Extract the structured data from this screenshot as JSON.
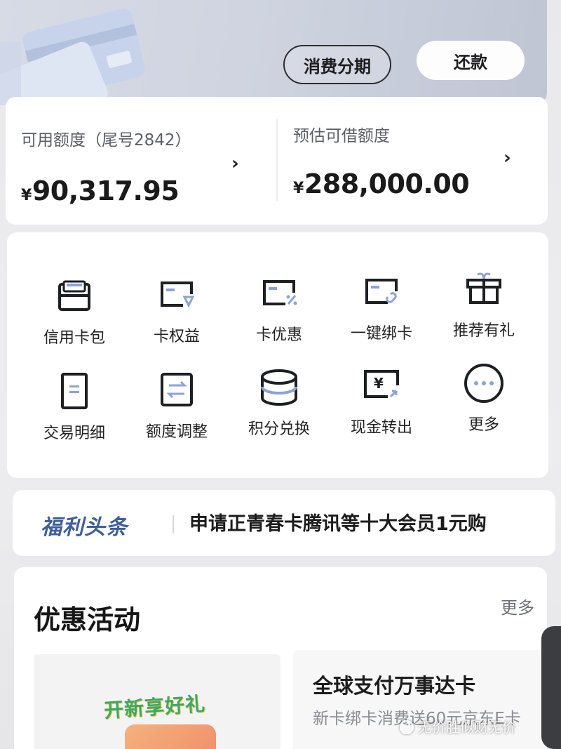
{
  "header": {
    "installment_button": "消费分期",
    "repay_button": "还款"
  },
  "credit": {
    "available_label": "可用额度（尾号2842）",
    "available_currency": "¥",
    "available_amount": "90,317.95",
    "borrow_label": "预估可借额度",
    "borrow_currency": "¥",
    "borrow_amount": "288,000.00"
  },
  "services": [
    {
      "label": "信用卡包",
      "icon": "card-wallet-icon"
    },
    {
      "label": "卡权益",
      "icon": "card-benefit-icon"
    },
    {
      "label": "卡优惠",
      "icon": "card-discount-icon"
    },
    {
      "label": "一键绑卡",
      "icon": "card-link-icon"
    },
    {
      "label": "推荐有礼",
      "icon": "gift-icon"
    },
    {
      "label": "交易明细",
      "icon": "document-icon"
    },
    {
      "label": "额度调整",
      "icon": "swap-arrows-icon"
    },
    {
      "label": "积分兑换",
      "icon": "coin-stack-icon"
    },
    {
      "label": "现金转出",
      "icon": "cash-transfer-icon"
    },
    {
      "label": "更多",
      "icon": "more-dots-icon"
    }
  ],
  "news": {
    "tag": "福利头条",
    "headline": "申请正青春卡腾讯等十大会员1元购"
  },
  "promo": {
    "title": "优惠活动",
    "more": "更多",
    "left_banner": "开新享好礼",
    "right_title": "全球支付万事达卡",
    "right_subtitle": "新卡绑卡消费送60元京东E卡"
  },
  "watermark": "无价胜似财无价",
  "colors": {
    "accent_blue": "#3e5f9a",
    "icon_stroke": "#1e1f23",
    "icon_accent": "#8aa2d8"
  }
}
